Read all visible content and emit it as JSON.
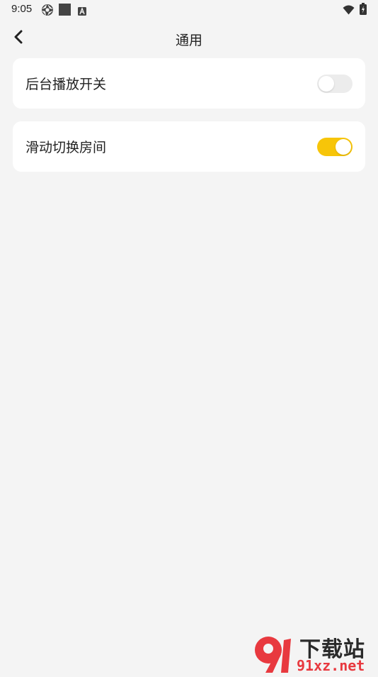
{
  "status_bar": {
    "time": "9:05",
    "icons": [
      "aperture-icon",
      "square-icon",
      "a-badge-icon",
      "wifi-icon",
      "battery-icon"
    ]
  },
  "app_bar": {
    "title": "通用",
    "back_icon": "chevron-left-icon"
  },
  "settings": [
    {
      "label": "后台播放开关",
      "enabled": false
    },
    {
      "label": "滑动切换房间",
      "enabled": true
    }
  ],
  "colors": {
    "accent": "#f7c509",
    "background": "#f4f4f4",
    "card": "#ffffff",
    "toggle_off": "#ececec",
    "watermark_red": "#e8393f"
  },
  "watermark": {
    "brand_text": "下载站",
    "url": "91xz.net"
  }
}
